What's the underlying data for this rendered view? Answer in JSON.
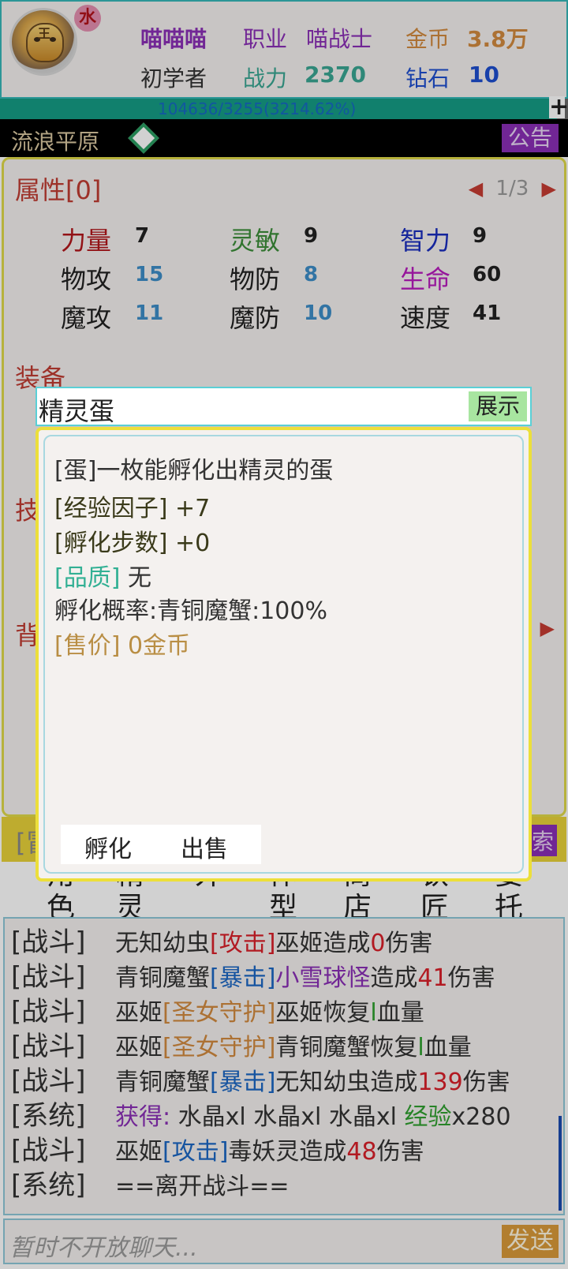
{
  "header": {
    "element_badge": "水",
    "name": "喵喵喵",
    "job_label": "职业",
    "job_value": "喵战士",
    "gold_label": "金币",
    "gold_value": "3.8万",
    "rank": "初学者",
    "power_label": "战力",
    "power_value": "2370",
    "diamond_label": "钻石",
    "diamond_value": "10",
    "exp_text": "104636/3255(3214.62%)",
    "plus_label": "+"
  },
  "mapbar": {
    "map_name": "流浪平原",
    "notice_label": "公告"
  },
  "attributes": {
    "title": "属性[0]",
    "page": "1/3",
    "stats": [
      {
        "label": "力量",
        "value": "7"
      },
      {
        "label": "灵敏",
        "value": "9"
      },
      {
        "label": "智力",
        "value": "9"
      },
      {
        "label": "物攻",
        "value": "15"
      },
      {
        "label": "物防",
        "value": "8"
      },
      {
        "label": "生命",
        "value": "60"
      },
      {
        "label": "魔攻",
        "value": "11"
      },
      {
        "label": "魔防",
        "value": "10"
      },
      {
        "label": "速度",
        "value": "41"
      }
    ]
  },
  "sections": {
    "equip": "装备",
    "skill": "技",
    "bag": "背"
  },
  "strip": {
    "left": "[冒",
    "right": "索"
  },
  "tabs": [
    "角色",
    "精灵",
    "外",
    "体型",
    "商店",
    "铁匠",
    "委托"
  ],
  "log": [
    {
      "tag": "[战斗]",
      "parts": [
        "无知幼虫",
        "[攻击]",
        "巫姬造成",
        "0",
        "伤害"
      ]
    },
    {
      "tag": "[战斗]",
      "parts": [
        "青铜魔蟹",
        "[暴击]",
        "小雪球怪",
        "造成",
        "41",
        "伤害"
      ]
    },
    {
      "tag": "[战斗]",
      "parts": [
        "巫姬",
        "[圣女守护]",
        "巫姬恢复",
        "l",
        "血量"
      ]
    },
    {
      "tag": "[战斗]",
      "parts": [
        "巫姬",
        "[圣女守护]",
        "青铜魔蟹恢复",
        "l",
        "血量"
      ]
    },
    {
      "tag": "[战斗]",
      "parts": [
        "青铜魔蟹",
        "[暴击]",
        "无知幼虫造成",
        "139",
        "伤害"
      ]
    },
    {
      "tag": "[系统]",
      "parts": [
        "获得:",
        " 水晶xl 水晶xl 水晶xl ",
        "经验",
        "x280"
      ]
    },
    {
      "tag": "[战斗]",
      "parts": [
        "巫姬",
        "[攻击]",
        "毒妖灵造成",
        "48",
        "伤害"
      ]
    },
    {
      "tag": "[系统]",
      "parts": [
        "==离开战斗=="
      ]
    }
  ],
  "chat": {
    "placeholder": "暂时不开放聊天...",
    "send_label": "发送"
  },
  "modal": {
    "title": "精灵蛋",
    "show_label": "展示",
    "desc": "[蛋]一枚能孵化出精灵的蛋",
    "exp_factor": "[经验因子] +7",
    "hatch_steps": "[孵化步数] +0",
    "quality_label": "[品质]",
    "quality_value": " 无",
    "hatch_rate": "孵化概率:青铜魔蟹:100%",
    "price_label": "[售价]",
    "price_value": " 0金币",
    "hatch_button": "孵化",
    "sell_button": "出售"
  },
  "colors": {
    "accent_teal": "#35b8b8",
    "panel_border": "#e0d94a",
    "modal_border": "#ecdf3a",
    "notice_purple": "#8a2fb6",
    "send_gold": "#d99a3a"
  },
  "exp_ratio": 0.98
}
